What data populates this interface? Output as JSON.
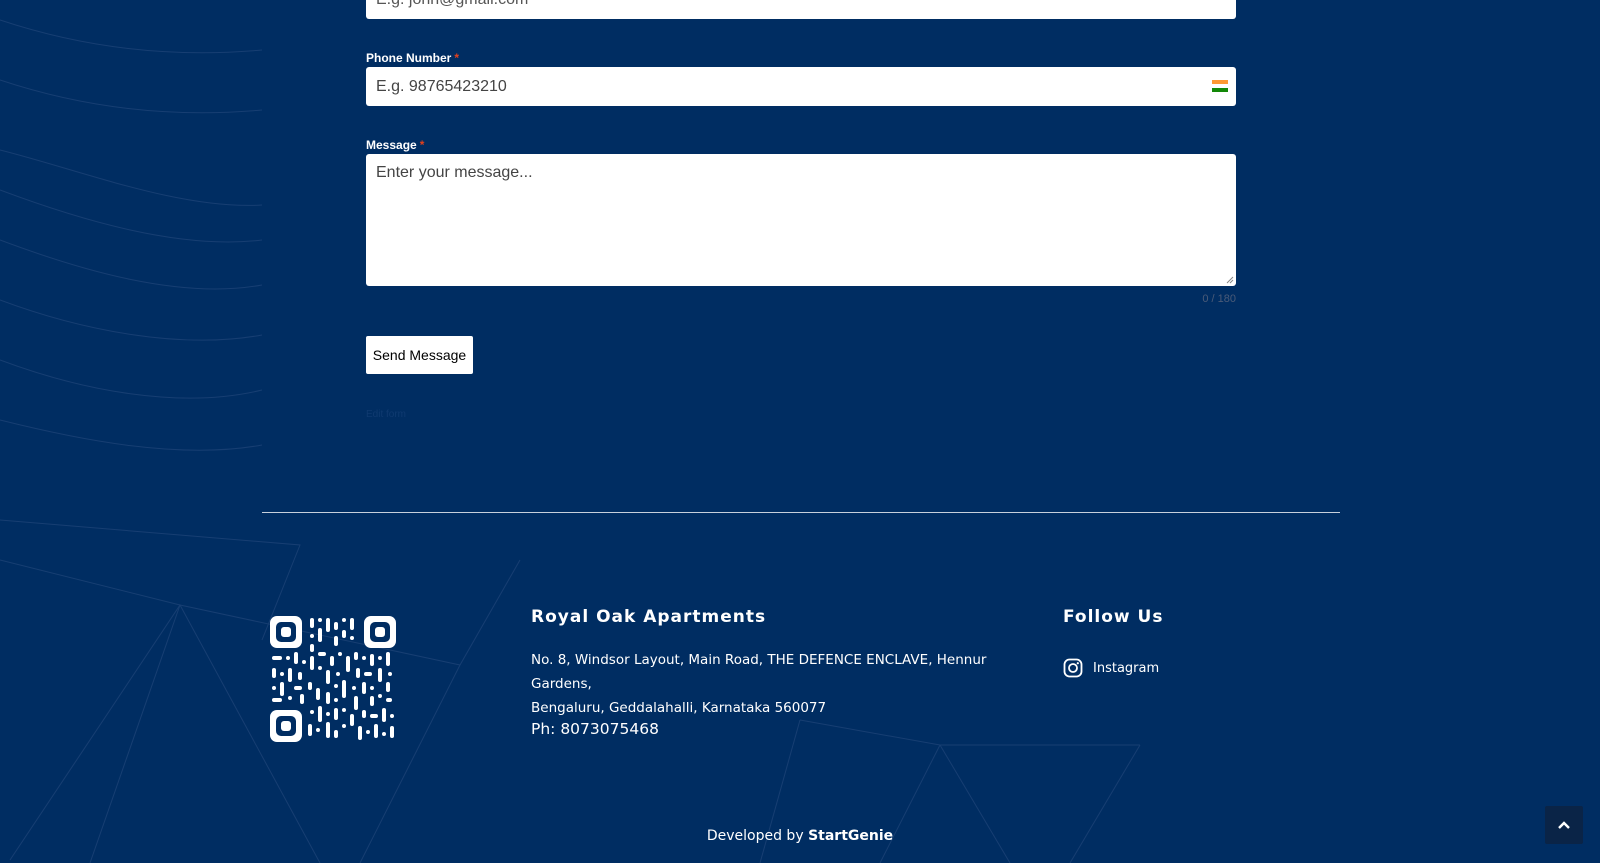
{
  "form": {
    "email": {
      "placeholder": "E.g. john@gmail.com"
    },
    "phone": {
      "label": "Phone Number",
      "required_mark": "*",
      "placeholder": "E.g. 98765423210",
      "flag_icon": "india-flag-icon"
    },
    "message": {
      "label": "Message",
      "required_mark": "*",
      "placeholder": "Enter your message...",
      "counter": "0 / 180"
    },
    "submit_label": "Send Message",
    "edit_link": "Edit form"
  },
  "footer": {
    "company_name": "Royal Oak Apartments",
    "address_line1": "No. 8, Windsor Layout, Main Road, THE DEFENCE ENCLAVE, Hennur Gardens,",
    "address_line2": "Bengaluru, Geddalahalli, Karnataka 560077",
    "phone": "Ph: 8073075468",
    "follow_title": "Follow Us",
    "social": [
      {
        "label": "Instagram",
        "icon": "instagram-icon"
      }
    ],
    "developed_by_prefix": "Developed by",
    "developer": "StartGenie"
  },
  "colors": {
    "background": "#002d62",
    "text": "#ffffff",
    "required": "#e2401c"
  }
}
